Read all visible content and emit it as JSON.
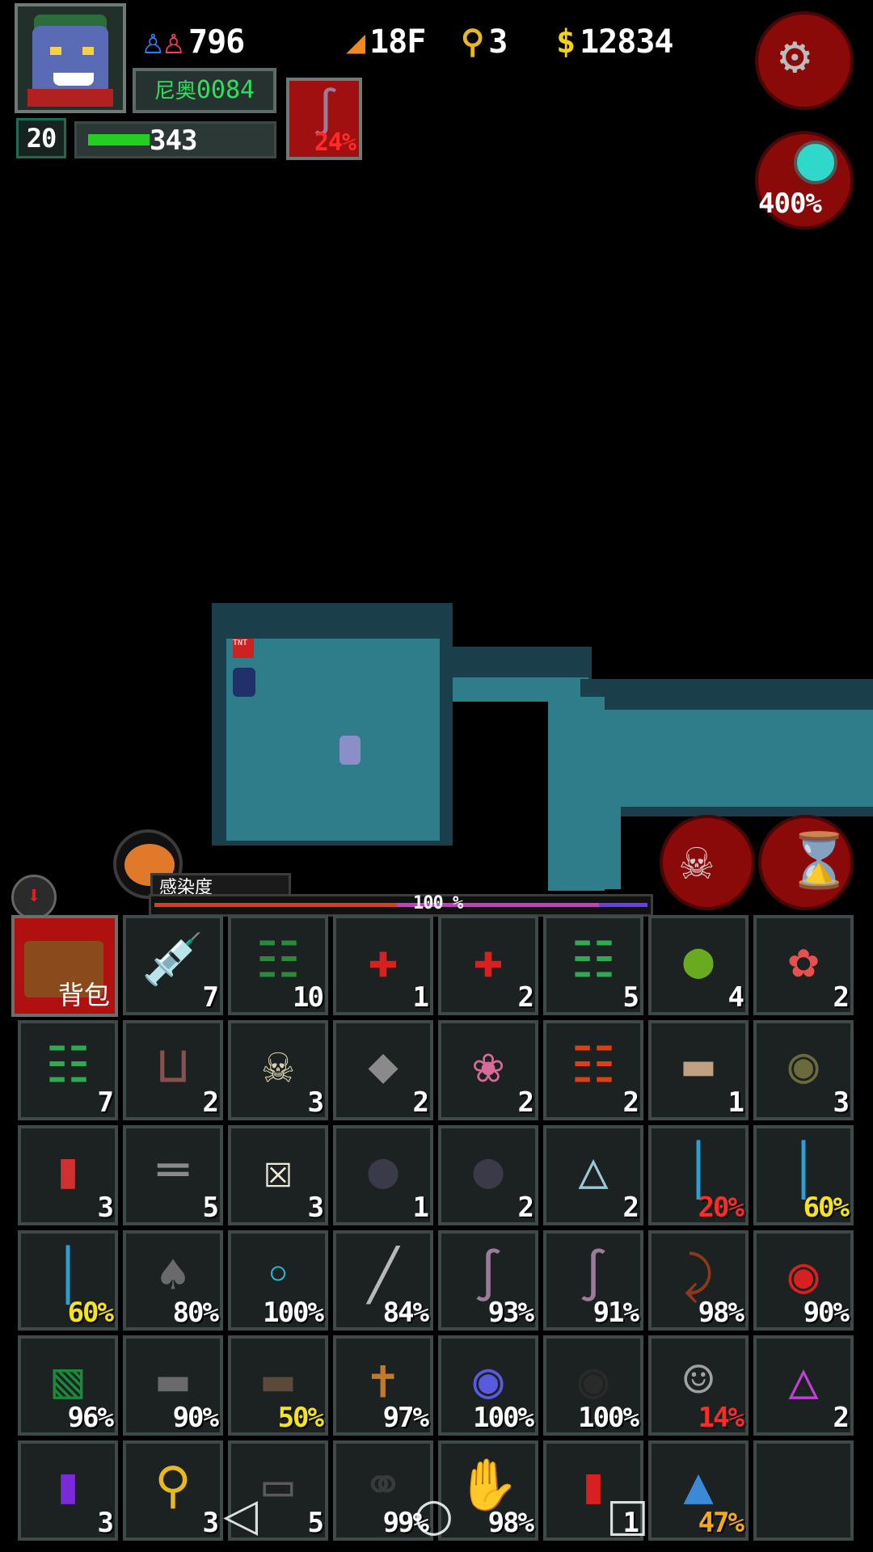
{
  "hud": {
    "population": "796",
    "floor": "18F",
    "keys": "3",
    "money": "12834",
    "name_prefix": "尼奥",
    "name_number": "0084",
    "level": "20",
    "hp": "343",
    "hp_fraction": 0.35,
    "weapon_durability": "24%",
    "zoom": "400%"
  },
  "infection": {
    "label": "感染度",
    "value": "100 %"
  },
  "bag_label": "背包",
  "inventory": [
    [
      {
        "icon": "syringe-icon",
        "value": "7",
        "color": "#ffffff"
      },
      {
        "icon": "beer-bottle-icon",
        "value": "10",
        "color": "#ffffff"
      },
      {
        "icon": "small-medkit-icon",
        "value": "1",
        "color": "#ffffff"
      },
      {
        "icon": "large-medkit-icon",
        "value": "2",
        "color": "#ffffff"
      },
      {
        "icon": "green-bottle-icon",
        "value": "5",
        "color": "#ffffff"
      },
      {
        "icon": "green-apple-icon",
        "value": "4",
        "color": "#ffffff"
      },
      {
        "icon": "brain-icon",
        "value": "2",
        "color": "#ffffff"
      }
    ],
    [
      {
        "icon": "green-bottle-icon",
        "value": "7",
        "color": "#ffffff"
      },
      {
        "icon": "bear-trap-icon",
        "value": "2",
        "color": "#ffffff"
      },
      {
        "icon": "skull-icon",
        "value": "3",
        "color": "#ffffff"
      },
      {
        "icon": "stone-icon",
        "value": "2",
        "color": "#ffffff"
      },
      {
        "icon": "flower-pot-icon",
        "value": "2",
        "color": "#ffffff"
      },
      {
        "icon": "hot-sauce-bottle-icon",
        "value": "2",
        "color": "#ffffff"
      },
      {
        "icon": "landmine-icon",
        "value": "1",
        "color": "#ffffff"
      },
      {
        "icon": "grenade-icon",
        "value": "3",
        "color": "#ffffff"
      }
    ],
    [
      {
        "icon": "small-vial-icon",
        "value": "3",
        "color": "#ffffff"
      },
      {
        "icon": "dumbbell-icon",
        "value": "5",
        "color": "#ffffff"
      },
      {
        "icon": "bone-icon",
        "value": "3",
        "color": "#ffffff"
      },
      {
        "icon": "bomb-icon",
        "value": "1",
        "color": "#ffffff"
      },
      {
        "icon": "bomb-icon",
        "value": "2",
        "color": "#ffffff"
      },
      {
        "icon": "flask-icon",
        "value": "2",
        "color": "#ffffff"
      },
      {
        "icon": "light-stick-icon",
        "value": "20%",
        "color": "#ff2a2a"
      },
      {
        "icon": "light-stick-icon",
        "value": "60%",
        "color": "#f5e31c"
      }
    ],
    [
      {
        "icon": "light-stick-icon",
        "value": "60%",
        "color": "#f5e31c"
      },
      {
        "icon": "shovel-icon",
        "value": "80%",
        "color": "#ffffff"
      },
      {
        "icon": "energy-blade-icon",
        "value": "100%",
        "color": "#ffffff"
      },
      {
        "icon": "knife-icon",
        "value": "84%",
        "color": "#ffffff"
      },
      {
        "icon": "tentacle-whip-icon",
        "value": "93%",
        "color": "#ffffff"
      },
      {
        "icon": "tentacle-whip-icon",
        "value": "91%",
        "color": "#ffffff"
      },
      {
        "icon": "cane-icon",
        "value": "98%",
        "color": "#ffffff"
      },
      {
        "icon": "boxing-glove-icon",
        "value": "90%",
        "color": "#ffffff"
      }
    ],
    [
      {
        "icon": "green-vest-icon",
        "value": "96%",
        "color": "#ffffff"
      },
      {
        "icon": "assault-rifle-icon",
        "value": "90%",
        "color": "#ffffff"
      },
      {
        "icon": "minigun-icon",
        "value": "50%",
        "color": "#f5e31c"
      },
      {
        "icon": "crossbow-icon",
        "value": "97%",
        "color": "#ffffff"
      },
      {
        "icon": "scope-icon",
        "value": "100%",
        "color": "#ffffff"
      },
      {
        "icon": "dark-helmet-icon",
        "value": "100%",
        "color": "#ffffff"
      },
      {
        "icon": "zombie-mask-icon",
        "value": "14%",
        "color": "#ff2a2a"
      },
      {
        "icon": "potion-icon",
        "value": "2",
        "color": "#ffffff"
      }
    ],
    [
      {
        "icon": "purple-capsule-icon",
        "value": "3",
        "color": "#ffffff"
      },
      {
        "icon": "key-icon",
        "value": "3",
        "color": "#ffffff"
      },
      {
        "icon": "card-reader-icon",
        "value": "5",
        "color": "#ffffff"
      },
      {
        "icon": "chain-icon",
        "value": "99%",
        "color": "#ffffff"
      },
      {
        "icon": "zombie-hand-icon",
        "value": "98%",
        "color": "#ffffff"
      },
      {
        "icon": "dynamite-bundle-icon",
        "value": "1",
        "color": "#ffffff"
      },
      {
        "icon": "monitor-icon",
        "value": "47%",
        "color": "#f5a81c"
      },
      {
        "icon": "empty-slot",
        "value": "",
        "color": "#ffffff"
      }
    ]
  ]
}
